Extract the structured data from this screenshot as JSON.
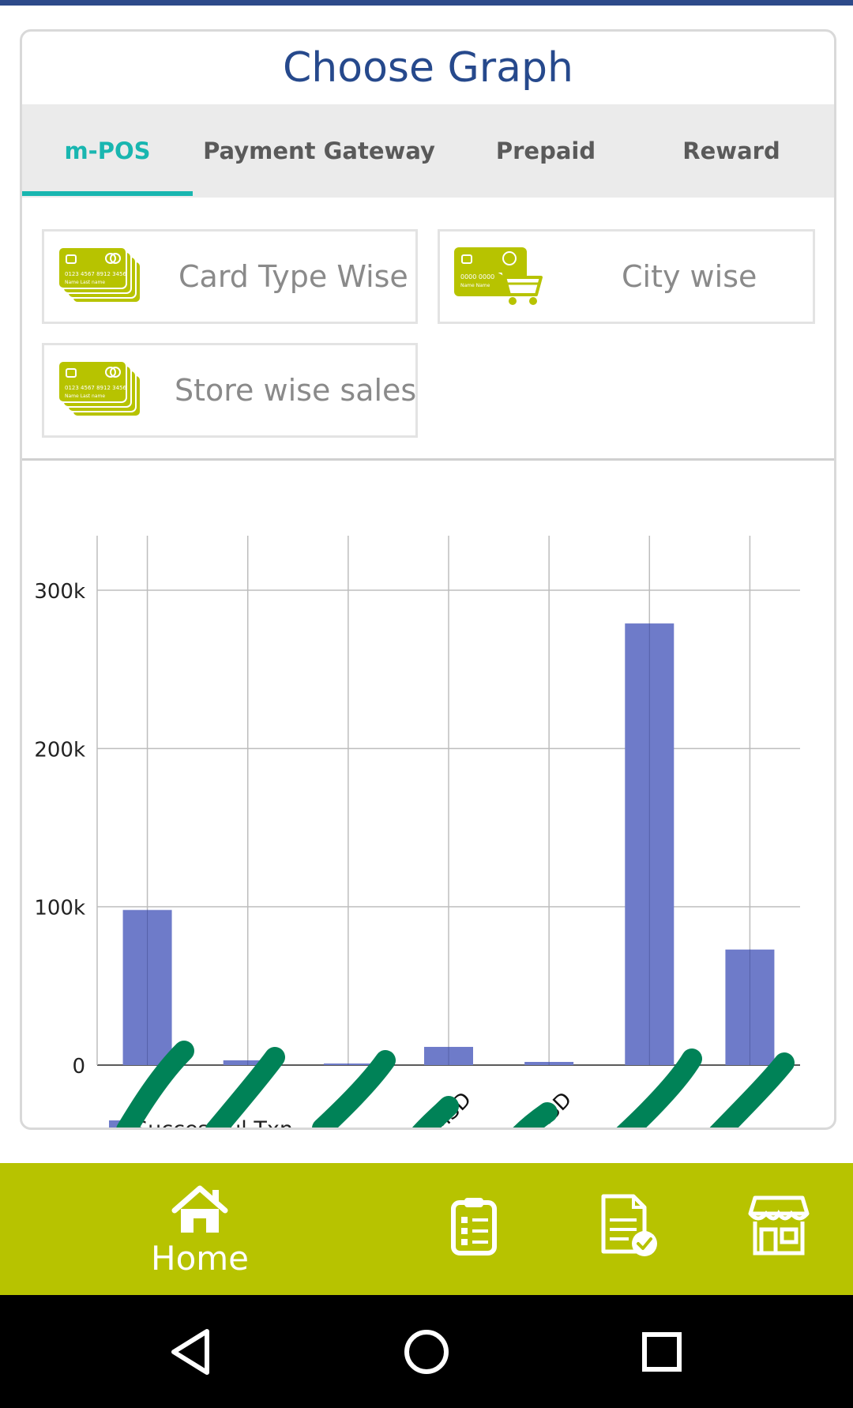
{
  "card": {
    "title": "Choose Graph",
    "tabs": [
      {
        "label": "m-POS",
        "active": true
      },
      {
        "label": "Payment Gateway",
        "active": false
      },
      {
        "label": "Prepaid",
        "active": false
      },
      {
        "label": "Reward",
        "active": false
      }
    ],
    "options": [
      {
        "label": "Card Type Wise",
        "icon": "credit-cards-icon",
        "card_text": "0123 4567 8912 3456",
        "card_name": "Name Last name"
      },
      {
        "label": "City wise",
        "icon": "card-cart-icon",
        "card_text": "0000 0000",
        "card_name": "Name Name"
      },
      {
        "label": "Store wise sales",
        "icon": "credit-cards-icon",
        "card_text": "0123 4567 8912 3456",
        "card_name": "Name Last name"
      }
    ]
  },
  "chart_data": {
    "type": "bar",
    "categories": [
      "",
      "",
      "",
      "SMSD",
      "SMSD",
      "",
      ""
    ],
    "series": [
      {
        "name": "Successful Txn.",
        "values": [
          98000,
          3000,
          1000,
          11500,
          2000,
          279000,
          73000
        ],
        "color": "#6e7bc9"
      }
    ],
    "ylim": [
      0,
      330000
    ],
    "yticks": [
      0,
      100000,
      200000,
      300000
    ],
    "ytick_labels": [
      "0",
      "100k",
      "200k",
      "300k"
    ],
    "grid": true,
    "legend": "bottom-left",
    "redacted_labels": true
  },
  "bottom_nav": {
    "items": [
      {
        "label": "Home",
        "icon": "home-icon"
      },
      {
        "label": "",
        "icon": "clipboard-list-icon"
      },
      {
        "label": "",
        "icon": "document-check-icon"
      },
      {
        "label": "",
        "icon": "store-icon"
      }
    ]
  },
  "system_nav": {
    "items": [
      "back-icon",
      "home-circle-icon",
      "recents-icon"
    ]
  },
  "colors": {
    "title": "#26498c",
    "tab_active": "#19b6b0",
    "bar": "#6e7bc9",
    "bottom_nav_bg": "#b7c300",
    "icon_green": "#b7c300",
    "redaction": "#008257"
  }
}
